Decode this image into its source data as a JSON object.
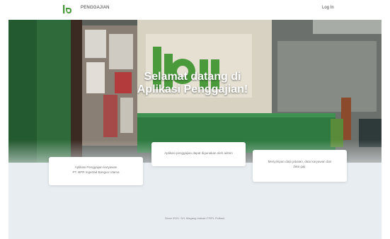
{
  "navbar": {
    "brand": "PENGGAJIAN",
    "login_label": "Log In",
    "logo_icon": "ibu-logo-icon",
    "logo_color": "#4a9a3b"
  },
  "hero": {
    "title_line1": "Selamat datang di",
    "title_line2": "Aplikasi Penggajian!"
  },
  "cards": [
    {
      "line1": "Aplikasi Penggajian karyawan",
      "line2": "PT. BPR Ingertad Bangun Utama"
    },
    {
      "line1": "Aplikasi penggajian dapat digunakan oleh admin"
    },
    {
      "line1": "Menyimpan data jabatan, data karyawan dan",
      "line2": "data gaji."
    }
  ],
  "footer": {
    "text": "Since 2021. SH. Magang Industri TRPL Politani."
  }
}
